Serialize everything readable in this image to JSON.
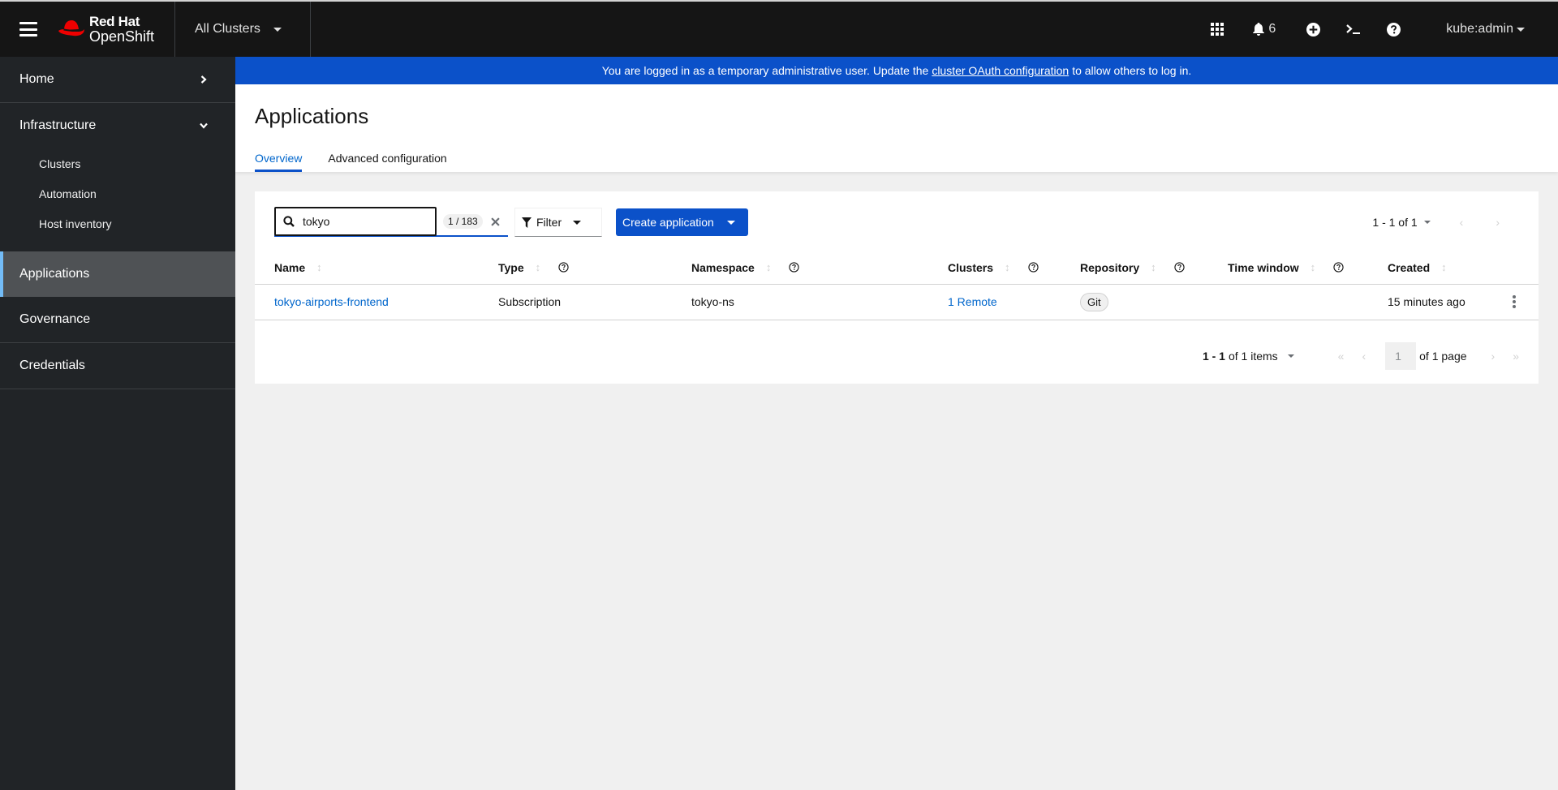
{
  "masthead": {
    "brand_line1": "Red Hat",
    "brand_line2": "OpenShift",
    "cluster_switcher": "All Clusters",
    "notification_count": "6",
    "user": "kube:admin",
    "icons": [
      "menu-icon",
      "app-launcher-icon",
      "bell-icon",
      "plus-circle-icon",
      "terminal-icon",
      "help-icon"
    ]
  },
  "sidebar": {
    "items": [
      {
        "label": "Home",
        "expanded": false
      },
      {
        "label": "Infrastructure",
        "expanded": true,
        "children": [
          "Clusters",
          "Automation",
          "Host inventory"
        ]
      },
      {
        "label": "Applications",
        "active": true
      },
      {
        "label": "Governance"
      },
      {
        "label": "Credentials"
      }
    ]
  },
  "banner": {
    "text_before": "You are logged in as a temporary administrative user. Update the",
    "link": "cluster OAuth configuration",
    "text_after": "to allow others to log in."
  },
  "page": {
    "title": "Applications",
    "tabs": [
      {
        "label": "Overview",
        "active": true
      },
      {
        "label": "Advanced configuration",
        "active": false
      }
    ]
  },
  "toolbar": {
    "search_value": "tokyo",
    "search_placeholder": "Search",
    "match_count": "1 / 183",
    "filter_label": "Filter",
    "create_label": "Create application",
    "pagination": "1 - 1 of 1"
  },
  "table": {
    "columns": [
      {
        "label": "Name",
        "help": false
      },
      {
        "label": "Type",
        "help": true
      },
      {
        "label": "Namespace",
        "help": true
      },
      {
        "label": "Clusters",
        "help": true
      },
      {
        "label": "Repository",
        "help": true
      },
      {
        "label": "Time window",
        "help": true
      },
      {
        "label": "Created",
        "help": false
      }
    ],
    "rows": [
      {
        "name": "tokyo-airports-frontend",
        "type": "Subscription",
        "namespace": "tokyo-ns",
        "clusters": "1 Remote",
        "repository": "Git",
        "time_window": "",
        "created": "15 minutes ago"
      }
    ]
  },
  "pagination": {
    "items_summary_bold": "1 - 1",
    "items_summary_rest": "of 1 items",
    "current_page": "1",
    "of_pages": "of 1 page"
  },
  "colors": {
    "accent": "#0b51c9",
    "link": "#0066cc",
    "masthead_bg": "#151515",
    "sidebar_bg": "#212427",
    "active_nav_bg": "#4f5255",
    "active_nav_marker": "#73bcf7",
    "brand_red": "#ee0000"
  }
}
